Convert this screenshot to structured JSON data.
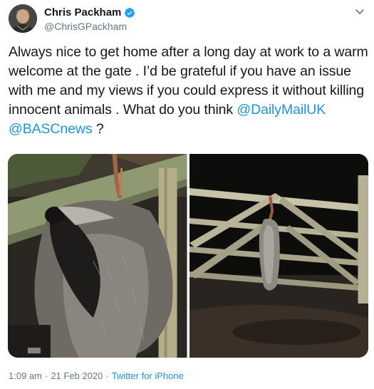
{
  "author": {
    "display_name": "Chris Packham",
    "handle": "@ChrisGPackham",
    "verified": true
  },
  "tweet": {
    "text_main": "Always nice to get home after a long day at work to a warm welcome at the gate . I’d be grateful if you have an issue with me and my views if you could express it without killing innocent animals . What do you think ",
    "mention_1": "@DailyMailUK",
    "mention_2": "@BASCnews",
    "text_end": " ?"
  },
  "meta": {
    "time": "1:09 am",
    "separator_1": "·",
    "date": "21 Feb 2020",
    "separator_2": "·",
    "source": "Twitter for iPhone"
  },
  "colors": {
    "link": "#1b95e0",
    "secondary_text": "#657786",
    "verified_badge": "#1da1f2"
  },
  "icons": {
    "verified": "verified-badge-icon",
    "more": "chevron-down-icon"
  }
}
